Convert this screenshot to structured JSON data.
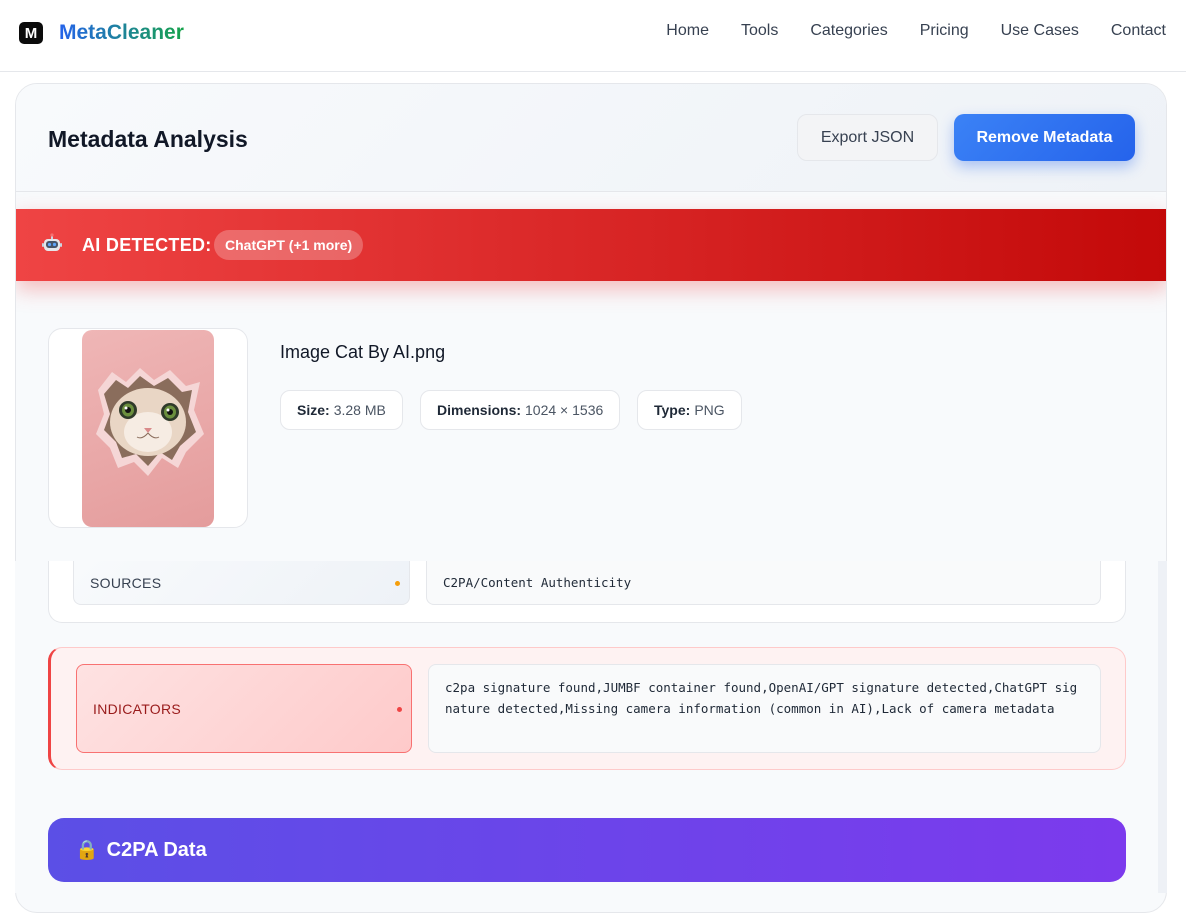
{
  "nav": {
    "logo_letter": "M",
    "brand": "MetaCleaner",
    "links": [
      "Home",
      "Tools",
      "Categories",
      "Pricing",
      "Use Cases",
      "Contact"
    ]
  },
  "header": {
    "title": "Metadata Analysis",
    "export_label": "Export JSON",
    "remove_label": "Remove Metadata"
  },
  "ai_banner": {
    "icon": "robot-icon",
    "label": "AI DETECTED:",
    "pill": "ChatGPT (+1 more)"
  },
  "file": {
    "name": "Image Cat By AI.png",
    "size_label": "Size:",
    "size_value": "3.28 MB",
    "dimensions_label": "Dimensions:",
    "dimensions_value": "1024 × 1536",
    "type_label": "Type:",
    "type_value": "PNG"
  },
  "rows": {
    "sources": {
      "key": "SOURCES",
      "value": "C2PA/Content Authenticity"
    },
    "indicators": {
      "key": "INDICATORS",
      "value": "c2pa signature found,JUMBF container found,OpenAI/GPT signature detected,ChatGPT signature detected,Missing camera information (common in AI),Lack of camera metadata"
    }
  },
  "c2pa": {
    "icon": "lock-icon",
    "title": "C2PA Data"
  },
  "colors": {
    "primary": "#2563eb",
    "ai_red": "#ef4444",
    "c2pa_purple": "#7c3aed"
  }
}
